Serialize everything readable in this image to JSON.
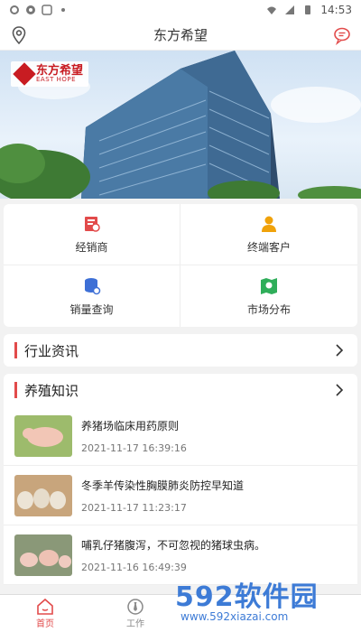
{
  "status": {
    "time": "14:53"
  },
  "header": {
    "title": "东方希望"
  },
  "brand": {
    "cn": "东方希望",
    "en": "EAST HOPE"
  },
  "menu": [
    {
      "label": "经销商",
      "icon": "dealer-icon"
    },
    {
      "label": "终端客户",
      "icon": "user-icon"
    },
    {
      "label": "销量查询",
      "icon": "database-search-icon"
    },
    {
      "label": "市场分布",
      "icon": "map-pin-icon"
    }
  ],
  "industry": {
    "label": "行业资讯"
  },
  "breeding": {
    "label": "养殖知识"
  },
  "articles": [
    {
      "title": "养猪场临床用药原则",
      "date": "2021-11-17 16:39:16"
    },
    {
      "title": "冬季羊传染性胸膜肺炎防控早知道",
      "date": "2021-11-17 11:23:17"
    },
    {
      "title": "哺乳仔猪腹泻，不可忽视的猪球虫病。",
      "date": "2021-11-16 16:49:39"
    }
  ],
  "tabs": [
    {
      "label": "首页",
      "active": true
    },
    {
      "label": "工作",
      "active": false
    }
  ],
  "watermark": {
    "big": "592软件园",
    "url": "www.592xiazai.com"
  },
  "colors": {
    "accent": "#e24b4b",
    "brand": "#c81c22"
  }
}
